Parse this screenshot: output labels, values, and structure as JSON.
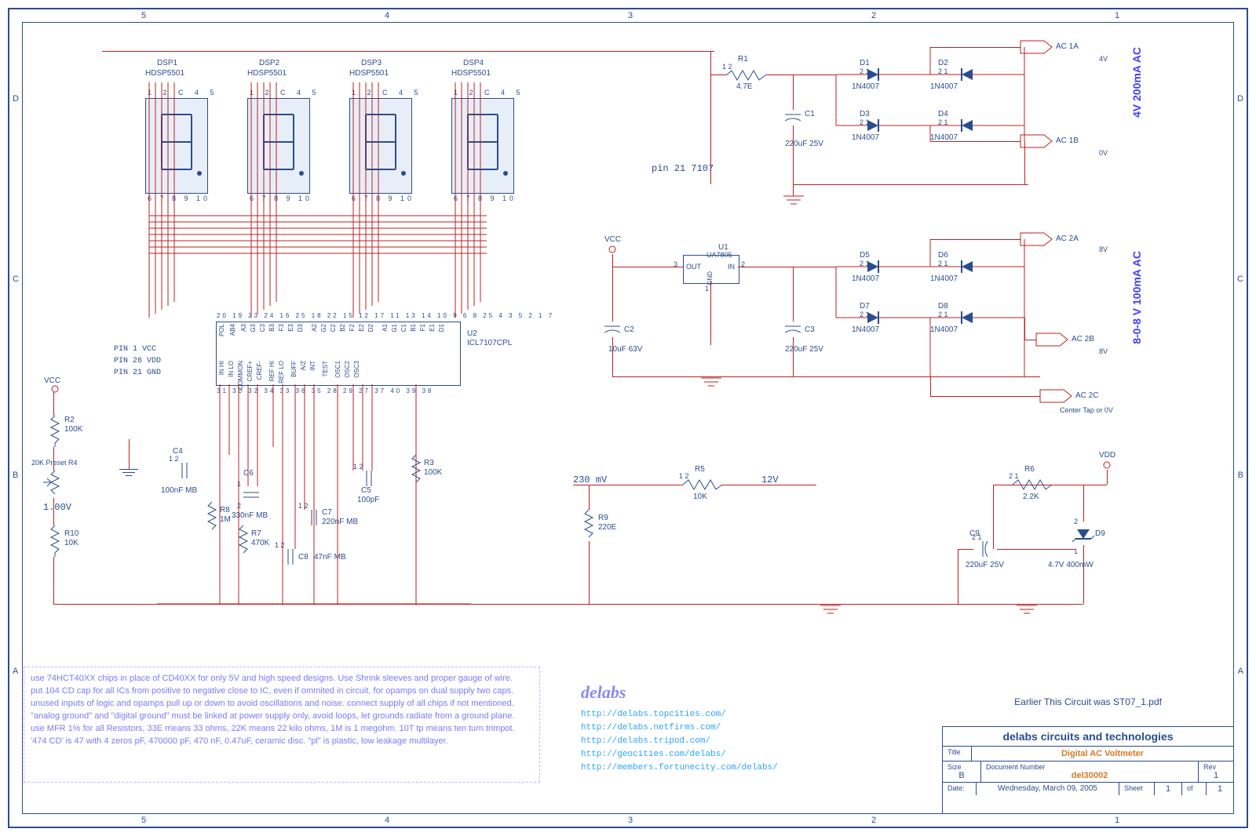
{
  "frame": {
    "ruler_top": [
      "5",
      "4",
      "3",
      "2",
      "1"
    ],
    "ruler_side": [
      "A",
      "B",
      "C",
      "D"
    ]
  },
  "displays": [
    {
      "ref": "DSP1",
      "part": "HDSP5501"
    },
    {
      "ref": "DSP2",
      "part": "HDSP5501"
    },
    {
      "ref": "DSP3",
      "part": "HDSP5501"
    },
    {
      "ref": "DSP4",
      "part": "HDSP5501"
    }
  ],
  "ic": {
    "u2_ref": "U2",
    "u2_part": "ICL7107CPL",
    "u1_ref": "U1",
    "u1_part": "UA7805",
    "u1_pins": {
      "out": "OUT",
      "gnd": "GND",
      "in": "IN"
    }
  },
  "pin_notes": {
    "p1": "PIN 1 VCC",
    "p26": "PIN 26 VDD",
    "p21": "PIN 21 GND",
    "pin21_7107": "pin 21 7107"
  },
  "u2_pins_top": [
    "POL",
    "AB4",
    "A3",
    "G3",
    "C3",
    "B3",
    "F3",
    "E3",
    "D3",
    "A2",
    "G2",
    "C2",
    "B2",
    "F2",
    "E2",
    "D2",
    "A1",
    "G1",
    "C1",
    "B1",
    "F1",
    "E1",
    "D1"
  ],
  "u2_pins_top_nums": [
    "20",
    "19",
    "23",
    "24",
    "16",
    "25",
    "18",
    "22",
    "15",
    "12",
    "17",
    "11",
    "13",
    "14",
    "10",
    "9",
    "6",
    "8",
    "25",
    "4",
    "3",
    "5",
    "2",
    "1",
    "7"
  ],
  "u2_pins_bottom": [
    "IN HI",
    "IN LO",
    "COMMON",
    "CREF+",
    "CREF-",
    "REF HI",
    "REF LO",
    "BUFF",
    "A/Z",
    "INT",
    "TEST",
    "OSC1",
    "OSC2",
    "OSC3"
  ],
  "u2_pins_bottom_nums": [
    "31",
    "30",
    "32",
    "34",
    "33",
    "36",
    "35",
    "28",
    "29",
    "27",
    "37",
    "40",
    "39",
    "38"
  ],
  "resistors": {
    "r1": {
      "ref": "R1",
      "val": "4.7E"
    },
    "r2": {
      "ref": "R2",
      "val": "100K"
    },
    "r3": {
      "ref": "R3",
      "val": "100K"
    },
    "r4": {
      "ref": "20K Preset\nR4"
    },
    "r5": {
      "ref": "R5",
      "val": "10K"
    },
    "r6": {
      "ref": "R6",
      "val": "2.2K"
    },
    "r7": {
      "ref": "R7",
      "val": "470K"
    },
    "r8": {
      "ref": "R8",
      "val": "1M"
    },
    "r9": {
      "ref": "R9",
      "val": "220E"
    },
    "r10": {
      "ref": "R10",
      "val": "10K"
    }
  },
  "caps": {
    "c1": {
      "ref": "C1",
      "val": "220uF 25V"
    },
    "c2": {
      "ref": "C2",
      "val": "10uF 63V"
    },
    "c3": {
      "ref": "C3",
      "val": "220uF 25V"
    },
    "c4": {
      "ref": "C4",
      "val": "100nF MB"
    },
    "c5": {
      "ref": "C5",
      "val": "100pF"
    },
    "c6": {
      "ref": "C6",
      "val": "330nF MB"
    },
    "c7": {
      "ref": "C7",
      "val": "220nF MB"
    },
    "c8": {
      "ref": "C8",
      "val": "47nF MB"
    },
    "c9": {
      "ref": "C9",
      "val": "220uF 25V"
    }
  },
  "diodes": {
    "d1": {
      "ref": "D1",
      "val": "1N4007"
    },
    "d2": {
      "ref": "D2",
      "val": "1N4007"
    },
    "d3": {
      "ref": "D3",
      "val": "1N4007"
    },
    "d4": {
      "ref": "D4",
      "val": "1N4007"
    },
    "d5": {
      "ref": "D5",
      "val": "1N4007"
    },
    "d6": {
      "ref": "D6",
      "val": "1N4007"
    },
    "d7": {
      "ref": "D7",
      "val": "1N4007"
    },
    "d8": {
      "ref": "D8",
      "val": "1N4007"
    },
    "d9": {
      "ref": "D9",
      "val": "4.7V 400mW"
    }
  },
  "ports": {
    "ac1a": "AC 1A",
    "ac1b": "AC 1B",
    "ac2a": "AC 2A",
    "ac2b": "AC 2B",
    "ac2c": "AC 2C",
    "vcc": "VCC",
    "vdd": "VDD"
  },
  "port_notes": {
    "v4": "4V",
    "v0": "0V",
    "v8": "8V",
    "v0b": "0V",
    "center": "Center Tap or 0V"
  },
  "side_labels": {
    "top": "4V 200mA AC",
    "bot": "8-0-8  V 100mA AC"
  },
  "signal_labels": {
    "v100": "1.00V",
    "mv230": "230 mV",
    "v12": "12V"
  },
  "notes": [
    "use 74HCT40XX chips in place of CD40XX for only 5V and high speed designs. Use Shrink sleeves and proper gauge of wire.",
    "put 104 CD cap for all ICs from positive to negative close to IC, even if ommited in circuit, for opamps on dual supply two caps.",
    "unused inputs of logic and opamps pull up or down to avoid oscillations and noise. connect supply of all chips if not mentioned.",
    "\"analog ground\" and \"digital ground\" must be linked at power supply only, avoid loops, let grounds radiate from a ground plane.",
    "use MFR 1% for all Resistors, 33E means 33 ohms, 22K means 22 kilo ohms, 1M is 1 megohm. 10T tp means ten turn trimpot.",
    "'474 CD' is 47 with 4 zeros pF, 470000 pF, 470 nF, 0.47uF, ceramic disc. \"pl\" is plastic, low leakage multilayer."
  ],
  "delabs": "delabs",
  "links": [
    "http://delabs.topcities.com/",
    "http://delabs.netfirms.com/",
    "http://delabs.tripod.com/",
    "http://geocities.com/delabs/",
    "http://members.fortunecity.com/delabs/"
  ],
  "title_block": {
    "earlier": "Earlier This Circuit was ST07_1.pdf",
    "company": "delabs circuits and technologies",
    "title_label": "Title",
    "title": "Digital AC Voltmeter",
    "size_label": "Size",
    "size": "B",
    "docnum_label": "Document Number",
    "docnum": "del30002",
    "rev_label": "Rev",
    "rev": "1",
    "date_label": "Date:",
    "date": "Wednesday, March 09, 2005",
    "sheet_label": "Sheet",
    "sheet_of": "of",
    "sheet_n": "1",
    "sheet_m": "1"
  }
}
